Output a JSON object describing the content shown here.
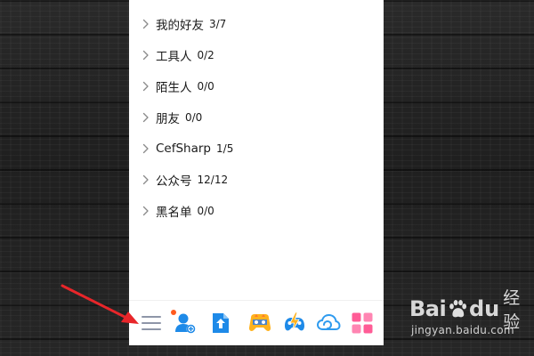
{
  "groups": [
    {
      "name": "我的好友",
      "count": "3/7"
    },
    {
      "name": "工具人",
      "count": "0/2"
    },
    {
      "name": "陌生人",
      "count": "0/0"
    },
    {
      "name": "朋友",
      "count": "0/0"
    },
    {
      "name": "CefSharp",
      "count": "1/5"
    },
    {
      "name": "公众号",
      "count": "12/12"
    },
    {
      "name": "黑名单",
      "count": "0/0"
    }
  ],
  "toolbar": {
    "icons": [
      "menu-icon",
      "add-friend-icon",
      "upload-icon",
      "game-center-icon",
      "game-bolt-icon",
      "cloud-icon",
      "apps-grid-icon"
    ],
    "notification_color": "#ff5a1f"
  },
  "annotation": {
    "arrow_color": "#e8262a"
  },
  "watermark": {
    "brand_left": "Bai",
    "brand_right": "du",
    "label": "经验",
    "url": "jingyan.baidu.com"
  }
}
